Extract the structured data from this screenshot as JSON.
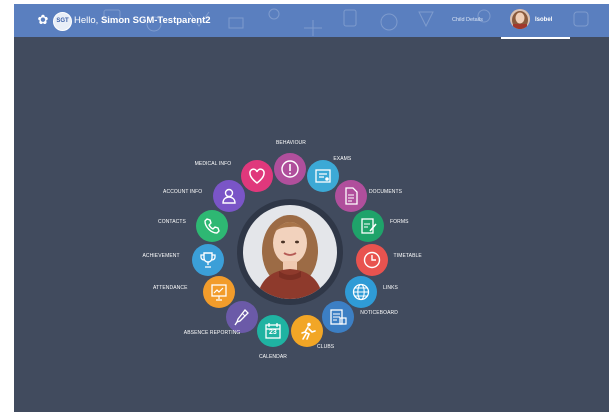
{
  "header": {
    "greeting_prefix": "Hello,",
    "user_name": "Simon SGM-Testparent2",
    "logo_text": "SGT",
    "child_link": "Child Details",
    "child_name": "Isobel",
    "bar_color": "#5a7fbf"
  },
  "menu": [
    {
      "label": "BEHAVIOUR",
      "icon": "exclamation-icon",
      "color": "#b04f9c"
    },
    {
      "label": "EXAMS",
      "icon": "certificate-icon",
      "color": "#3ca9d6"
    },
    {
      "label": "DOCUMENTS",
      "icon": "document-icon",
      "color": "#b04f9c"
    },
    {
      "label": "FORMS",
      "icon": "form-icon",
      "color": "#1fa36a"
    },
    {
      "label": "TIMETABLE",
      "icon": "clock-icon",
      "color": "#e8534f"
    },
    {
      "label": "LINKS",
      "icon": "globe-icon",
      "color": "#2f9bd6"
    },
    {
      "label": "NOTICEBOARD",
      "icon": "noticeboard-icon",
      "color": "#3c7fc4"
    },
    {
      "label": "CLUBS",
      "icon": "running-icon",
      "color": "#f2a626"
    },
    {
      "label": "CALENDAR",
      "icon": "calendar-icon",
      "color": "#1fb3a2",
      "icon_text": "23"
    },
    {
      "label": "ABSENCE REPORTING",
      "icon": "thermometer-icon",
      "color": "#6b5aa8"
    },
    {
      "label": "ATTENDANCE",
      "icon": "chart-board-icon",
      "color": "#f29c2b"
    },
    {
      "label": "ACHIEVEMENT",
      "icon": "trophy-icon",
      "color": "#3b9fd8"
    },
    {
      "label": "CONTACTS",
      "icon": "phone-icon",
      "color": "#2eb873"
    },
    {
      "label": "ACCOUNT INFO",
      "icon": "user-icon",
      "color": "#7a55c7"
    },
    {
      "label": "MEDICAL INFO",
      "icon": "heart-icon",
      "color": "#e0387c"
    }
  ]
}
